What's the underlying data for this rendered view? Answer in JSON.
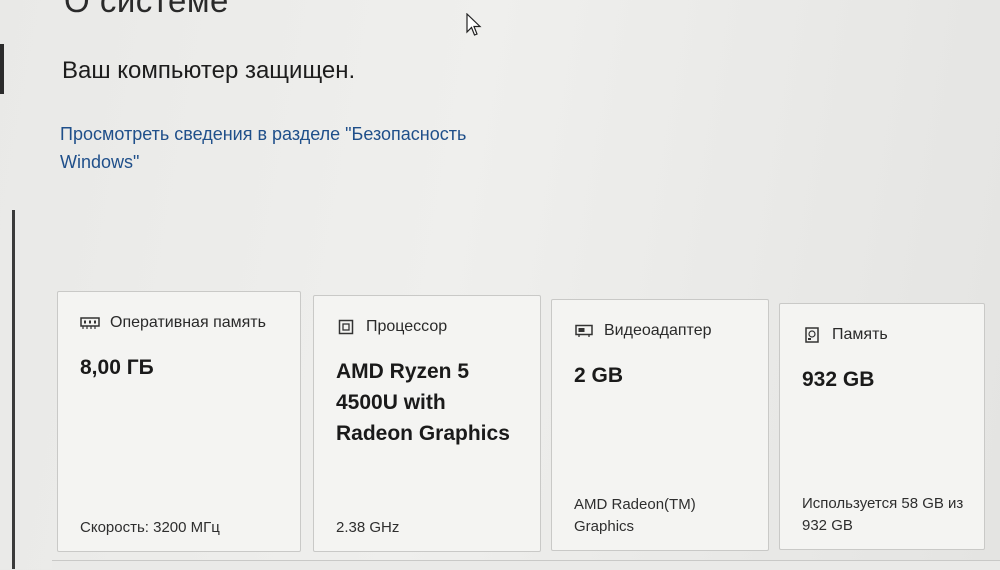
{
  "page": {
    "title": "О системе",
    "status": "Ваш компьютер защищен.",
    "security_link": "Просмотреть сведения в разделе \"Безопасность Windows\""
  },
  "cards": {
    "ram": {
      "icon": "memory-module-icon",
      "label": "Оперативная память",
      "value": "8,00 ГБ",
      "detail": "Скорость: 3200 МГц"
    },
    "cpu": {
      "icon": "processor-chip-icon",
      "label": "Процессор",
      "value": "AMD Ryzen 5 4500U with Radeon Graphics",
      "detail": "2.38 GHz"
    },
    "gpu": {
      "icon": "graphics-card-icon",
      "label": "Видеоадаптер",
      "value": "2 GB",
      "detail": "AMD Radeon(TM) Graphics"
    },
    "storage": {
      "icon": "storage-drive-icon",
      "label": "Память",
      "value": "932 GB",
      "detail": "Используется 58 GB из 932 GB"
    }
  },
  "colors": {
    "link": "#1f4f8a",
    "card_bg": "#f4f4f2",
    "card_border": "#c9c9c7"
  }
}
